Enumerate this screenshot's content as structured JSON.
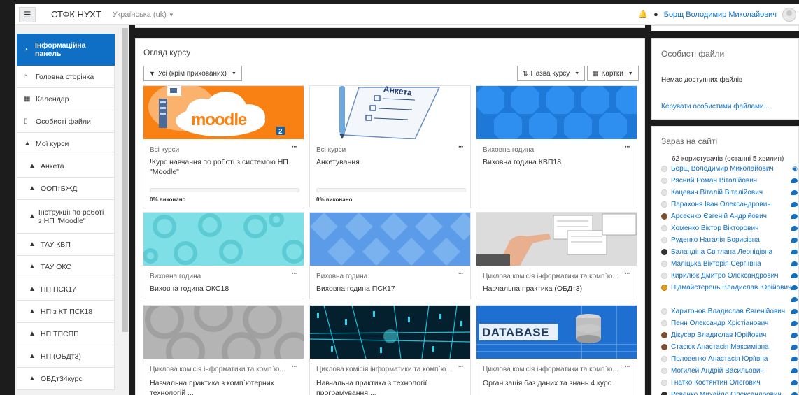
{
  "navbar": {
    "brand": "СТФК НУХТ",
    "language": "Українська (uk)",
    "user_name": "Борщ Володимир Миколайович"
  },
  "sidebar": {
    "items": [
      {
        "label": "Інформаційна панель",
        "icon": "dashboard-icon",
        "active": true
      },
      {
        "label": "Головна сторінка",
        "icon": "home-icon"
      },
      {
        "label": "Календар",
        "icon": "calendar-icon"
      },
      {
        "label": "Особисті файли",
        "icon": "file-icon"
      },
      {
        "label": "Мої курси",
        "icon": "graduation-cap-icon"
      },
      {
        "label": "Анкета",
        "icon": "graduation-cap-icon"
      },
      {
        "label": "ООПтБЖД",
        "icon": "graduation-cap-icon"
      },
      {
        "label": "Інструкції по роботі з НП \"Moodle\"",
        "icon": "graduation-cap-icon"
      },
      {
        "label": "ТАУ КВП",
        "icon": "graduation-cap-icon"
      },
      {
        "label": "ТАУ ОКС",
        "icon": "graduation-cap-icon"
      },
      {
        "label": "ПП ПСК17",
        "icon": "graduation-cap-icon"
      },
      {
        "label": "НП з КТ ПСК18",
        "icon": "graduation-cap-icon"
      },
      {
        "label": "НП ТПСПП",
        "icon": "graduation-cap-icon"
      },
      {
        "label": "НП (ОБДт3)",
        "icon": "graduation-cap-icon"
      },
      {
        "label": "ОБДт34курс",
        "icon": "graduation-cap-icon"
      }
    ]
  },
  "overview": {
    "title": "Огляд курсу",
    "filter_label": "Усі (крім прихованих)",
    "sort_label": "Назва курсу",
    "view_label": "Картки",
    "cards": [
      {
        "category": "Всі курси",
        "title": "!Курс навчання по роботі з системою НП \"Moodle\"",
        "progress_text": "0% виконано",
        "progress": 0
      },
      {
        "category": "Всі курси",
        "title": "Анкетування",
        "progress_text": "0% виконано",
        "progress": 0,
        "image_text": "Анкета"
      },
      {
        "category": "Виховна година",
        "title": "Виховна година КВП18"
      },
      {
        "category": "Виховна година",
        "title": "Виховна година ОКС18"
      },
      {
        "category": "Виховна година",
        "title": "Виховна година ПСК17"
      },
      {
        "category": "Циклова комісія інформатики та комп`ю...",
        "title": "Навчальна практика (ОБДт3)"
      },
      {
        "category": "Циклова комісія інформатики та комп`ю...",
        "title": "Навчальна практика з комп`ютерних технологій ..."
      },
      {
        "category": "Циклова комісія інформатики та комп`ю...",
        "title": "Навчальна практика з технології програмування ..."
      },
      {
        "category": "Циклова комісія інформатики та комп`ю...",
        "title": "Організація баз даних та знань 4 курс",
        "image_text": "DATABASE"
      }
    ],
    "logo_text": "moodle"
  },
  "private_files": {
    "title": "Особисті файли",
    "empty_text": "Немає доступних файлів",
    "manage_link": "Керувати особистими файлами..."
  },
  "online_users": {
    "title": "Зараз на сайті",
    "summary": "62 користувачів (останні 5 хвилин)",
    "users": [
      {
        "name": "Борщ Володимир Миколайович",
        "action": "eye",
        "pic": ""
      },
      {
        "name": "Рясний Роман Віталійович",
        "action": "msg",
        "pic": ""
      },
      {
        "name": "Кацевич Віталій Віталійович",
        "action": "msg",
        "pic": ""
      },
      {
        "name": "Парахоня Іван Олександрович",
        "action": "msg",
        "pic": ""
      },
      {
        "name": "Арсеєнко Євгеній Андрійович",
        "action": "msg",
        "pic": "brown"
      },
      {
        "name": "Хоменко Віктор Вікторович",
        "action": "msg",
        "pic": ""
      },
      {
        "name": "Руденко Наталія Борисівна",
        "action": "msg",
        "pic": ""
      },
      {
        "name": "Баландіна Світлана Леонідівна",
        "action": "msg",
        "pic": "dark"
      },
      {
        "name": "Маліцька Вікторія Сергіївна",
        "action": "msg",
        "pic": ""
      },
      {
        "name": "Кирилюк Дмитро Олександрович",
        "action": "msg",
        "pic": ""
      },
      {
        "name": "Підмайстерець Владислав Юрійович",
        "action": "msg",
        "pic": "orange"
      },
      {
        "name": "",
        "action": "msg",
        "pic": "none"
      },
      {
        "name": "Харитонов Владислав Євгенійович",
        "action": "msg",
        "pic": ""
      },
      {
        "name": "Пенн Олександр Хрістіанович",
        "action": "msg",
        "pic": ""
      },
      {
        "name": "Дікусар Владислав Юрійович",
        "action": "msg",
        "pic": "brown"
      },
      {
        "name": "Стасюк Анастасія Максимівна",
        "action": "msg",
        "pic": "brown"
      },
      {
        "name": "Половенко Анастасія Юріївна",
        "action": "msg",
        "pic": ""
      },
      {
        "name": "Могилей Андрій Васильович",
        "action": "msg",
        "pic": ""
      },
      {
        "name": "Гнатко Костянтин Олегович",
        "action": "msg",
        "pic": ""
      },
      {
        "name": "Ревенко Михайло Олександрович",
        "action": "msg",
        "pic": "dark"
      }
    ]
  },
  "colors": {
    "accent": "#0f6fc5",
    "moodle_orange": "#f98012"
  }
}
